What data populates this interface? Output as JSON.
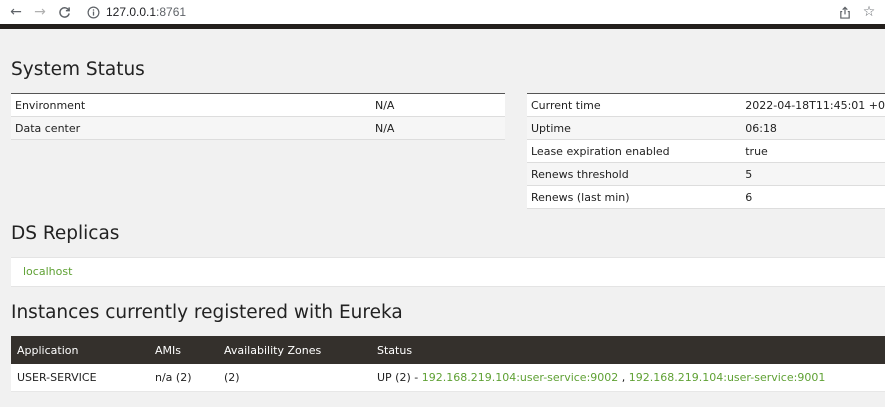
{
  "browser": {
    "url_host": "127.0.0.1",
    "url_port": ":8761"
  },
  "system_status": {
    "title": "System Status",
    "left_rows": [
      {
        "label": "Environment",
        "value": "N/A"
      },
      {
        "label": "Data center",
        "value": "N/A"
      }
    ],
    "right_rows": [
      {
        "label": "Current time",
        "value": "2022-04-18T11:45:01 +0"
      },
      {
        "label": "Uptime",
        "value": "06:18"
      },
      {
        "label": "Lease expiration enabled",
        "value": "true"
      },
      {
        "label": "Renews threshold",
        "value": "5"
      },
      {
        "label": "Renews (last min)",
        "value": "6"
      }
    ]
  },
  "ds_replicas": {
    "title": "DS Replicas",
    "items": [
      "localhost"
    ]
  },
  "instances": {
    "title": "Instances currently registered with Eureka",
    "columns": [
      "Application",
      "AMIs",
      "Availability Zones",
      "Status"
    ],
    "rows": [
      {
        "application": "USER-SERVICE",
        "amis": "n/a (2)",
        "zones": "(2)",
        "status_prefix": "UP (2) - ",
        "link1": "192.168.219.104:user-service:9002",
        "separator": " , ",
        "link2": "192.168.219.104:user-service:9001"
      }
    ]
  },
  "colors": {
    "link_green": "#5fa134",
    "header_dark": "#34302c",
    "top_bar": "#231f1c"
  }
}
